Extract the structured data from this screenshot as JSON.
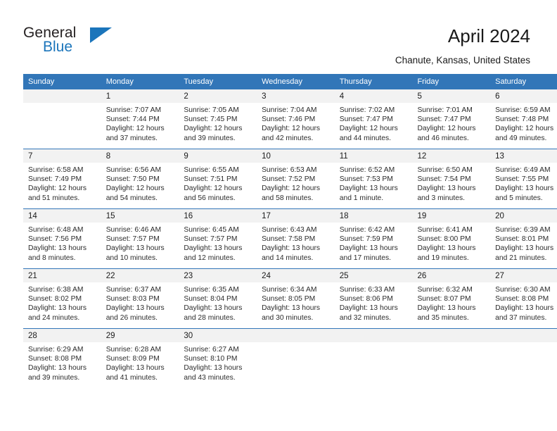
{
  "brand": {
    "line1": "General",
    "line2": "Blue",
    "flag_icon": "triangle-flag-icon",
    "color_text": "#231f20",
    "color_accent": "#1b75bb"
  },
  "header": {
    "title": "April 2024",
    "location": "Chanute, Kansas, United States"
  },
  "calendar": {
    "header_bg": "#3276b8",
    "daynum_bg": "#f2f2f2",
    "weekday_names": [
      "Sunday",
      "Monday",
      "Tuesday",
      "Wednesday",
      "Thursday",
      "Friday",
      "Saturday"
    ],
    "weeks": [
      [
        {
          "day": "",
          "sunrise": "",
          "sunset": "",
          "daylight1": "",
          "daylight2": "",
          "empty": true
        },
        {
          "day": "1",
          "sunrise": "Sunrise: 7:07 AM",
          "sunset": "Sunset: 7:44 PM",
          "daylight1": "Daylight: 12 hours",
          "daylight2": "and 37 minutes."
        },
        {
          "day": "2",
          "sunrise": "Sunrise: 7:05 AM",
          "sunset": "Sunset: 7:45 PM",
          "daylight1": "Daylight: 12 hours",
          "daylight2": "and 39 minutes."
        },
        {
          "day": "3",
          "sunrise": "Sunrise: 7:04 AM",
          "sunset": "Sunset: 7:46 PM",
          "daylight1": "Daylight: 12 hours",
          "daylight2": "and 42 minutes."
        },
        {
          "day": "4",
          "sunrise": "Sunrise: 7:02 AM",
          "sunset": "Sunset: 7:47 PM",
          "daylight1": "Daylight: 12 hours",
          "daylight2": "and 44 minutes."
        },
        {
          "day": "5",
          "sunrise": "Sunrise: 7:01 AM",
          "sunset": "Sunset: 7:47 PM",
          "daylight1": "Daylight: 12 hours",
          "daylight2": "and 46 minutes."
        },
        {
          "day": "6",
          "sunrise": "Sunrise: 6:59 AM",
          "sunset": "Sunset: 7:48 PM",
          "daylight1": "Daylight: 12 hours",
          "daylight2": "and 49 minutes."
        }
      ],
      [
        {
          "day": "7",
          "sunrise": "Sunrise: 6:58 AM",
          "sunset": "Sunset: 7:49 PM",
          "daylight1": "Daylight: 12 hours",
          "daylight2": "and 51 minutes."
        },
        {
          "day": "8",
          "sunrise": "Sunrise: 6:56 AM",
          "sunset": "Sunset: 7:50 PM",
          "daylight1": "Daylight: 12 hours",
          "daylight2": "and 54 minutes."
        },
        {
          "day": "9",
          "sunrise": "Sunrise: 6:55 AM",
          "sunset": "Sunset: 7:51 PM",
          "daylight1": "Daylight: 12 hours",
          "daylight2": "and 56 minutes."
        },
        {
          "day": "10",
          "sunrise": "Sunrise: 6:53 AM",
          "sunset": "Sunset: 7:52 PM",
          "daylight1": "Daylight: 12 hours",
          "daylight2": "and 58 minutes."
        },
        {
          "day": "11",
          "sunrise": "Sunrise: 6:52 AM",
          "sunset": "Sunset: 7:53 PM",
          "daylight1": "Daylight: 13 hours",
          "daylight2": "and 1 minute."
        },
        {
          "day": "12",
          "sunrise": "Sunrise: 6:50 AM",
          "sunset": "Sunset: 7:54 PM",
          "daylight1": "Daylight: 13 hours",
          "daylight2": "and 3 minutes."
        },
        {
          "day": "13",
          "sunrise": "Sunrise: 6:49 AM",
          "sunset": "Sunset: 7:55 PM",
          "daylight1": "Daylight: 13 hours",
          "daylight2": "and 5 minutes."
        }
      ],
      [
        {
          "day": "14",
          "sunrise": "Sunrise: 6:48 AM",
          "sunset": "Sunset: 7:56 PM",
          "daylight1": "Daylight: 13 hours",
          "daylight2": "and 8 minutes."
        },
        {
          "day": "15",
          "sunrise": "Sunrise: 6:46 AM",
          "sunset": "Sunset: 7:57 PM",
          "daylight1": "Daylight: 13 hours",
          "daylight2": "and 10 minutes."
        },
        {
          "day": "16",
          "sunrise": "Sunrise: 6:45 AM",
          "sunset": "Sunset: 7:57 PM",
          "daylight1": "Daylight: 13 hours",
          "daylight2": "and 12 minutes."
        },
        {
          "day": "17",
          "sunrise": "Sunrise: 6:43 AM",
          "sunset": "Sunset: 7:58 PM",
          "daylight1": "Daylight: 13 hours",
          "daylight2": "and 14 minutes."
        },
        {
          "day": "18",
          "sunrise": "Sunrise: 6:42 AM",
          "sunset": "Sunset: 7:59 PM",
          "daylight1": "Daylight: 13 hours",
          "daylight2": "and 17 minutes."
        },
        {
          "day": "19",
          "sunrise": "Sunrise: 6:41 AM",
          "sunset": "Sunset: 8:00 PM",
          "daylight1": "Daylight: 13 hours",
          "daylight2": "and 19 minutes."
        },
        {
          "day": "20",
          "sunrise": "Sunrise: 6:39 AM",
          "sunset": "Sunset: 8:01 PM",
          "daylight1": "Daylight: 13 hours",
          "daylight2": "and 21 minutes."
        }
      ],
      [
        {
          "day": "21",
          "sunrise": "Sunrise: 6:38 AM",
          "sunset": "Sunset: 8:02 PM",
          "daylight1": "Daylight: 13 hours",
          "daylight2": "and 24 minutes."
        },
        {
          "day": "22",
          "sunrise": "Sunrise: 6:37 AM",
          "sunset": "Sunset: 8:03 PM",
          "daylight1": "Daylight: 13 hours",
          "daylight2": "and 26 minutes."
        },
        {
          "day": "23",
          "sunrise": "Sunrise: 6:35 AM",
          "sunset": "Sunset: 8:04 PM",
          "daylight1": "Daylight: 13 hours",
          "daylight2": "and 28 minutes."
        },
        {
          "day": "24",
          "sunrise": "Sunrise: 6:34 AM",
          "sunset": "Sunset: 8:05 PM",
          "daylight1": "Daylight: 13 hours",
          "daylight2": "and 30 minutes."
        },
        {
          "day": "25",
          "sunrise": "Sunrise: 6:33 AM",
          "sunset": "Sunset: 8:06 PM",
          "daylight1": "Daylight: 13 hours",
          "daylight2": "and 32 minutes."
        },
        {
          "day": "26",
          "sunrise": "Sunrise: 6:32 AM",
          "sunset": "Sunset: 8:07 PM",
          "daylight1": "Daylight: 13 hours",
          "daylight2": "and 35 minutes."
        },
        {
          "day": "27",
          "sunrise": "Sunrise: 6:30 AM",
          "sunset": "Sunset: 8:08 PM",
          "daylight1": "Daylight: 13 hours",
          "daylight2": "and 37 minutes."
        }
      ],
      [
        {
          "day": "28",
          "sunrise": "Sunrise: 6:29 AM",
          "sunset": "Sunset: 8:08 PM",
          "daylight1": "Daylight: 13 hours",
          "daylight2": "and 39 minutes."
        },
        {
          "day": "29",
          "sunrise": "Sunrise: 6:28 AM",
          "sunset": "Sunset: 8:09 PM",
          "daylight1": "Daylight: 13 hours",
          "daylight2": "and 41 minutes."
        },
        {
          "day": "30",
          "sunrise": "Sunrise: 6:27 AM",
          "sunset": "Sunset: 8:10 PM",
          "daylight1": "Daylight: 13 hours",
          "daylight2": "and 43 minutes."
        },
        {
          "day": "",
          "sunrise": "",
          "sunset": "",
          "daylight1": "",
          "daylight2": "",
          "empty": true
        },
        {
          "day": "",
          "sunrise": "",
          "sunset": "",
          "daylight1": "",
          "daylight2": "",
          "empty": true
        },
        {
          "day": "",
          "sunrise": "",
          "sunset": "",
          "daylight1": "",
          "daylight2": "",
          "empty": true
        },
        {
          "day": "",
          "sunrise": "",
          "sunset": "",
          "daylight1": "",
          "daylight2": "",
          "empty": true
        }
      ]
    ]
  }
}
